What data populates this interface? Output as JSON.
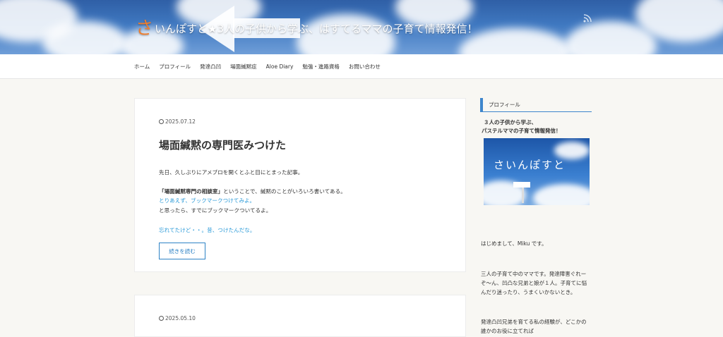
{
  "header": {
    "title_first": "さ",
    "title_rest": "いんぽすと★3人の子供から学ぶ、はすてるママの子育て情報発信！"
  },
  "nav": {
    "items": [
      "ホーム",
      "プロフィール",
      "発達凸凹",
      "場面緘黙症",
      "Aloe Diary",
      "勉強・進路資格",
      "お問い合わせ"
    ]
  },
  "post1": {
    "date": "2025.07.12",
    "title": "場面緘黙の専門医みつけた",
    "line1": "先日、久しぶりにアメブロを開くとふと目にとまった記事。",
    "line2_bold": "「場面緘黙専門の相談室」",
    "line2_rest": "ということで、緘黙のことがいろいろ書いてある。",
    "line3": "とりあえず、ブックマークつけてみよ。",
    "line4": "と思ったら、すでにブックマークついてるよ。",
    "line5": "忘れてたけど・・。昔、つけたんだな。",
    "more_label": "続きを読む"
  },
  "post2": {
    "date": "2025.05.10"
  },
  "sidebar": {
    "widget_title": "プロフィール",
    "tagline1": "３人の子供から学ぶ、",
    "tagline2": "パステルママの子育て情報発信！",
    "image_text": "さいんぽすと",
    "p1": "はじめまして、Miku です。",
    "p2a": "三人の子育て中のママです。発達障害ぐれー",
    "p2b": "ぞ～ん、凹凸な兄弟と娘が１人。子育てに悩",
    "p2c": "んだり迷ったり、うまくいかないとき。",
    "p3a": "発達凸凹兄弟を育てる私の経験が、どこかの",
    "p3b": "誰かのお役に立てれば"
  },
  "colors": {
    "accent_blue": "#2e83c6",
    "link_blue": "#2a9ad8",
    "title_orange": "#ef7e2e"
  }
}
